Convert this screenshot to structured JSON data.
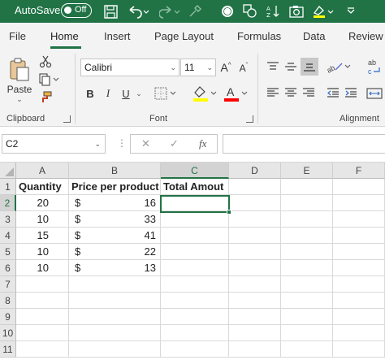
{
  "titlebar": {
    "autosave_label": "AutoSave",
    "autosave_state": "Off",
    "bg_color": "#217346",
    "icons": [
      "save-icon",
      "undo-icon",
      "redo-icon",
      "brush-icon",
      "record-icon",
      "shapes-icon",
      "sort-icon",
      "camera-icon",
      "highlight-icon",
      "customize-icon"
    ]
  },
  "tabs": [
    {
      "label": "File",
      "active": false
    },
    {
      "label": "Home",
      "active": true
    },
    {
      "label": "Insert",
      "active": false
    },
    {
      "label": "Page Layout",
      "active": false
    },
    {
      "label": "Formulas",
      "active": false
    },
    {
      "label": "Data",
      "active": false
    },
    {
      "label": "Review",
      "active": false
    }
  ],
  "ribbon": {
    "clipboard": {
      "label": "Clipboard",
      "paste_label": "Paste"
    },
    "font": {
      "label": "Font",
      "font_name": "Calibri",
      "font_size": "11",
      "bold": "B",
      "italic": "I",
      "underline": "U",
      "fill_color": "#ffff00",
      "font_color": "#ff0000"
    },
    "alignment": {
      "label": "Alignment"
    }
  },
  "formula_bar": {
    "name_box": "C2",
    "cancel": "✕",
    "enter": "✓",
    "fx": "fx",
    "value": ""
  },
  "sheet": {
    "columns": [
      "A",
      "B",
      "C",
      "D",
      "E",
      "F"
    ],
    "rows": [
      "1",
      "2",
      "3",
      "4",
      "5",
      "6",
      "7",
      "8",
      "9",
      "10",
      "11"
    ],
    "headers": {
      "A": "Quantity",
      "B": "Price per product",
      "C": "Total Amout"
    },
    "data": [
      {
        "quantity": "20",
        "currency": "$",
        "price": "16"
      },
      {
        "quantity": "10",
        "currency": "$",
        "price": "33"
      },
      {
        "quantity": "15",
        "currency": "$",
        "price": "41"
      },
      {
        "quantity": "10",
        "currency": "$",
        "price": "22"
      },
      {
        "quantity": "10",
        "currency": "$",
        "price": "13"
      }
    ],
    "selected_cell": "C2",
    "accent_color": "#217346"
  }
}
